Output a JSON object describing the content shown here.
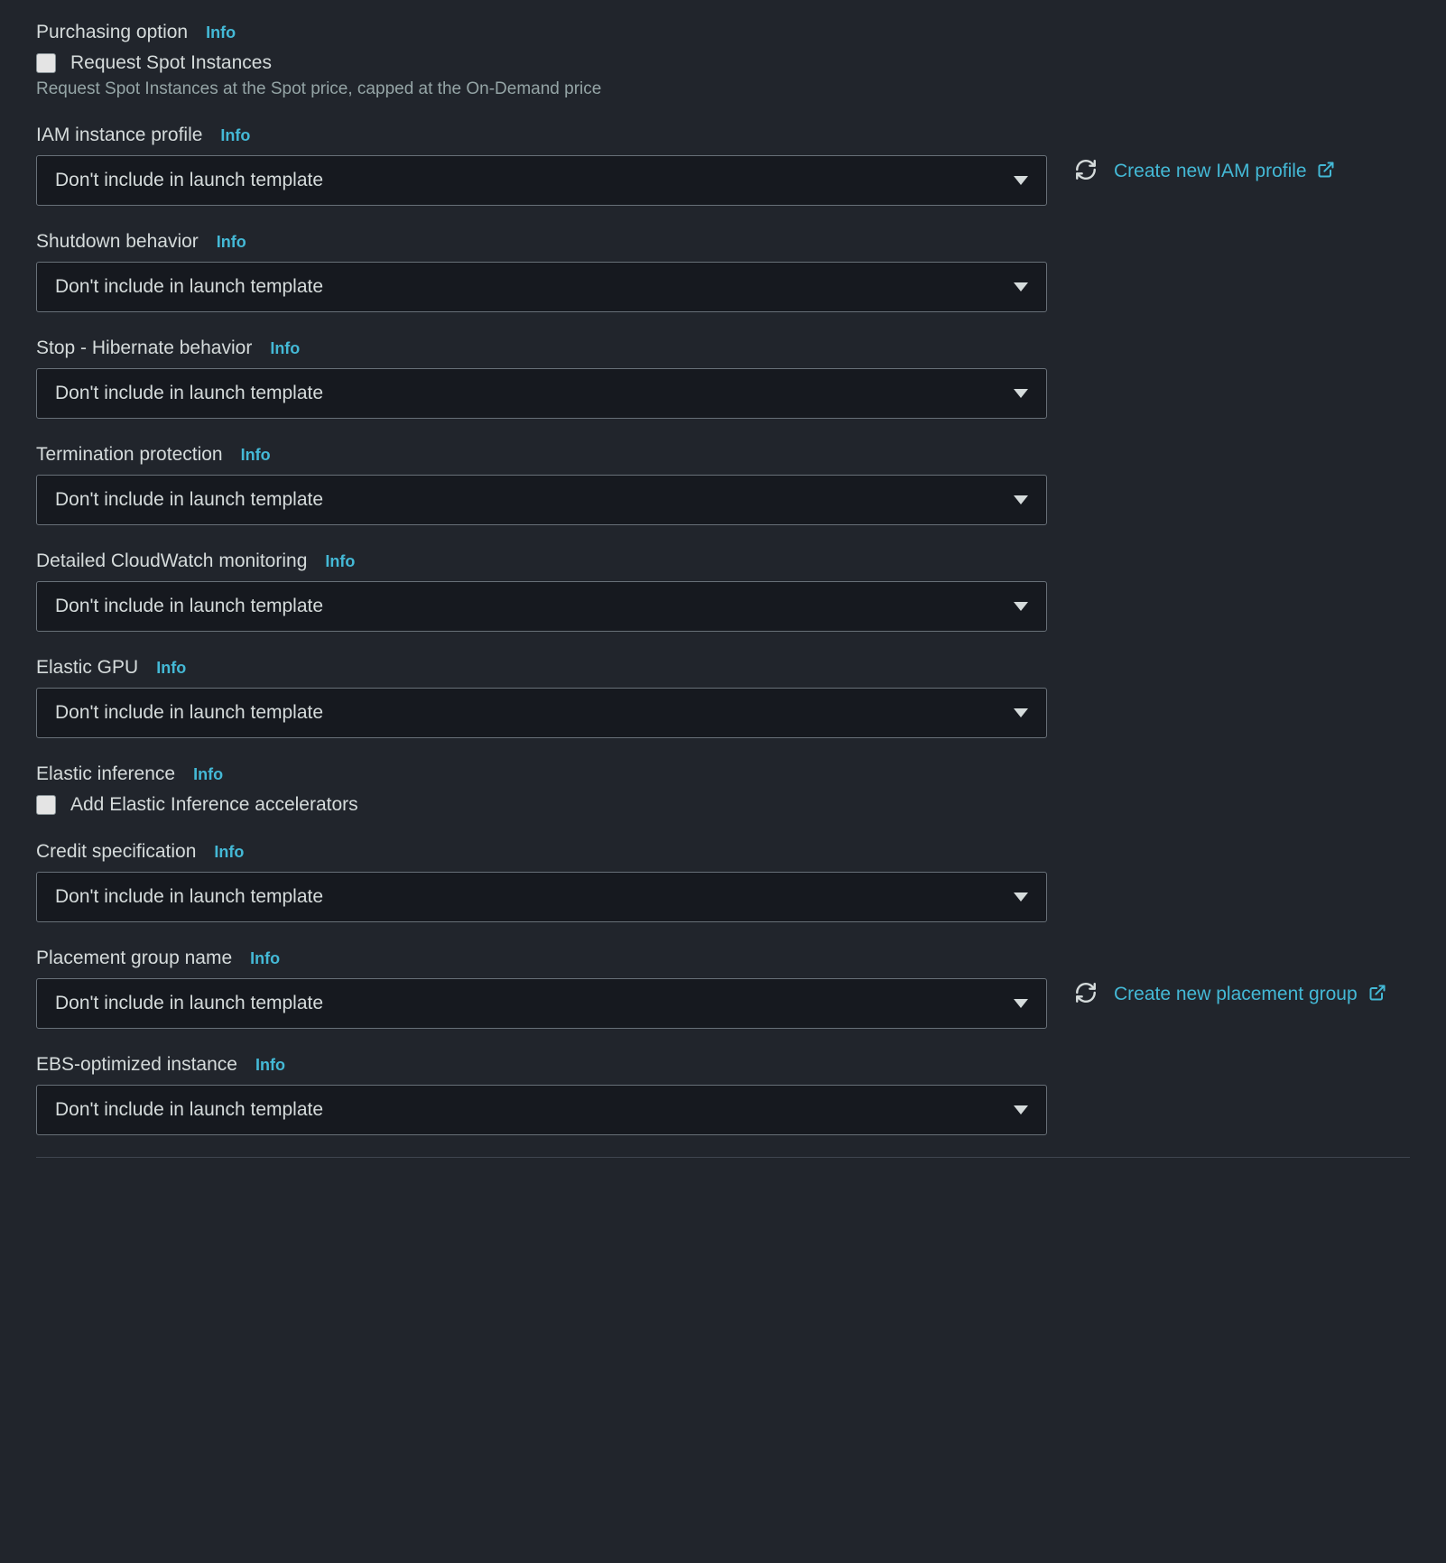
{
  "info_label": "Info",
  "default_select_value": "Don't include in launch template",
  "purchasing": {
    "label": "Purchasing option",
    "checkbox_label": "Request Spot Instances",
    "helper": "Request Spot Instances at the Spot price, capped at the On-Demand price"
  },
  "iam": {
    "label": "IAM instance profile",
    "value": "Don't include in launch template",
    "create_link": "Create new IAM profile"
  },
  "shutdown": {
    "label": "Shutdown behavior",
    "value": "Don't include in launch template"
  },
  "stop_hibernate": {
    "label": "Stop - Hibernate behavior",
    "value": "Don't include in launch template"
  },
  "termination": {
    "label": "Termination protection",
    "value": "Don't include in launch template"
  },
  "cloudwatch": {
    "label": "Detailed CloudWatch monitoring",
    "value": "Don't include in launch template"
  },
  "elastic_gpu": {
    "label": "Elastic GPU",
    "value": "Don't include in launch template"
  },
  "elastic_inference": {
    "label": "Elastic inference",
    "checkbox_label": "Add Elastic Inference accelerators"
  },
  "credit": {
    "label": "Credit specification",
    "value": "Don't include in launch template"
  },
  "placement": {
    "label": "Placement group name",
    "value": "Don't include in launch template",
    "create_link": "Create new placement group"
  },
  "ebs": {
    "label": "EBS-optimized instance",
    "value": "Don't include in launch template"
  }
}
